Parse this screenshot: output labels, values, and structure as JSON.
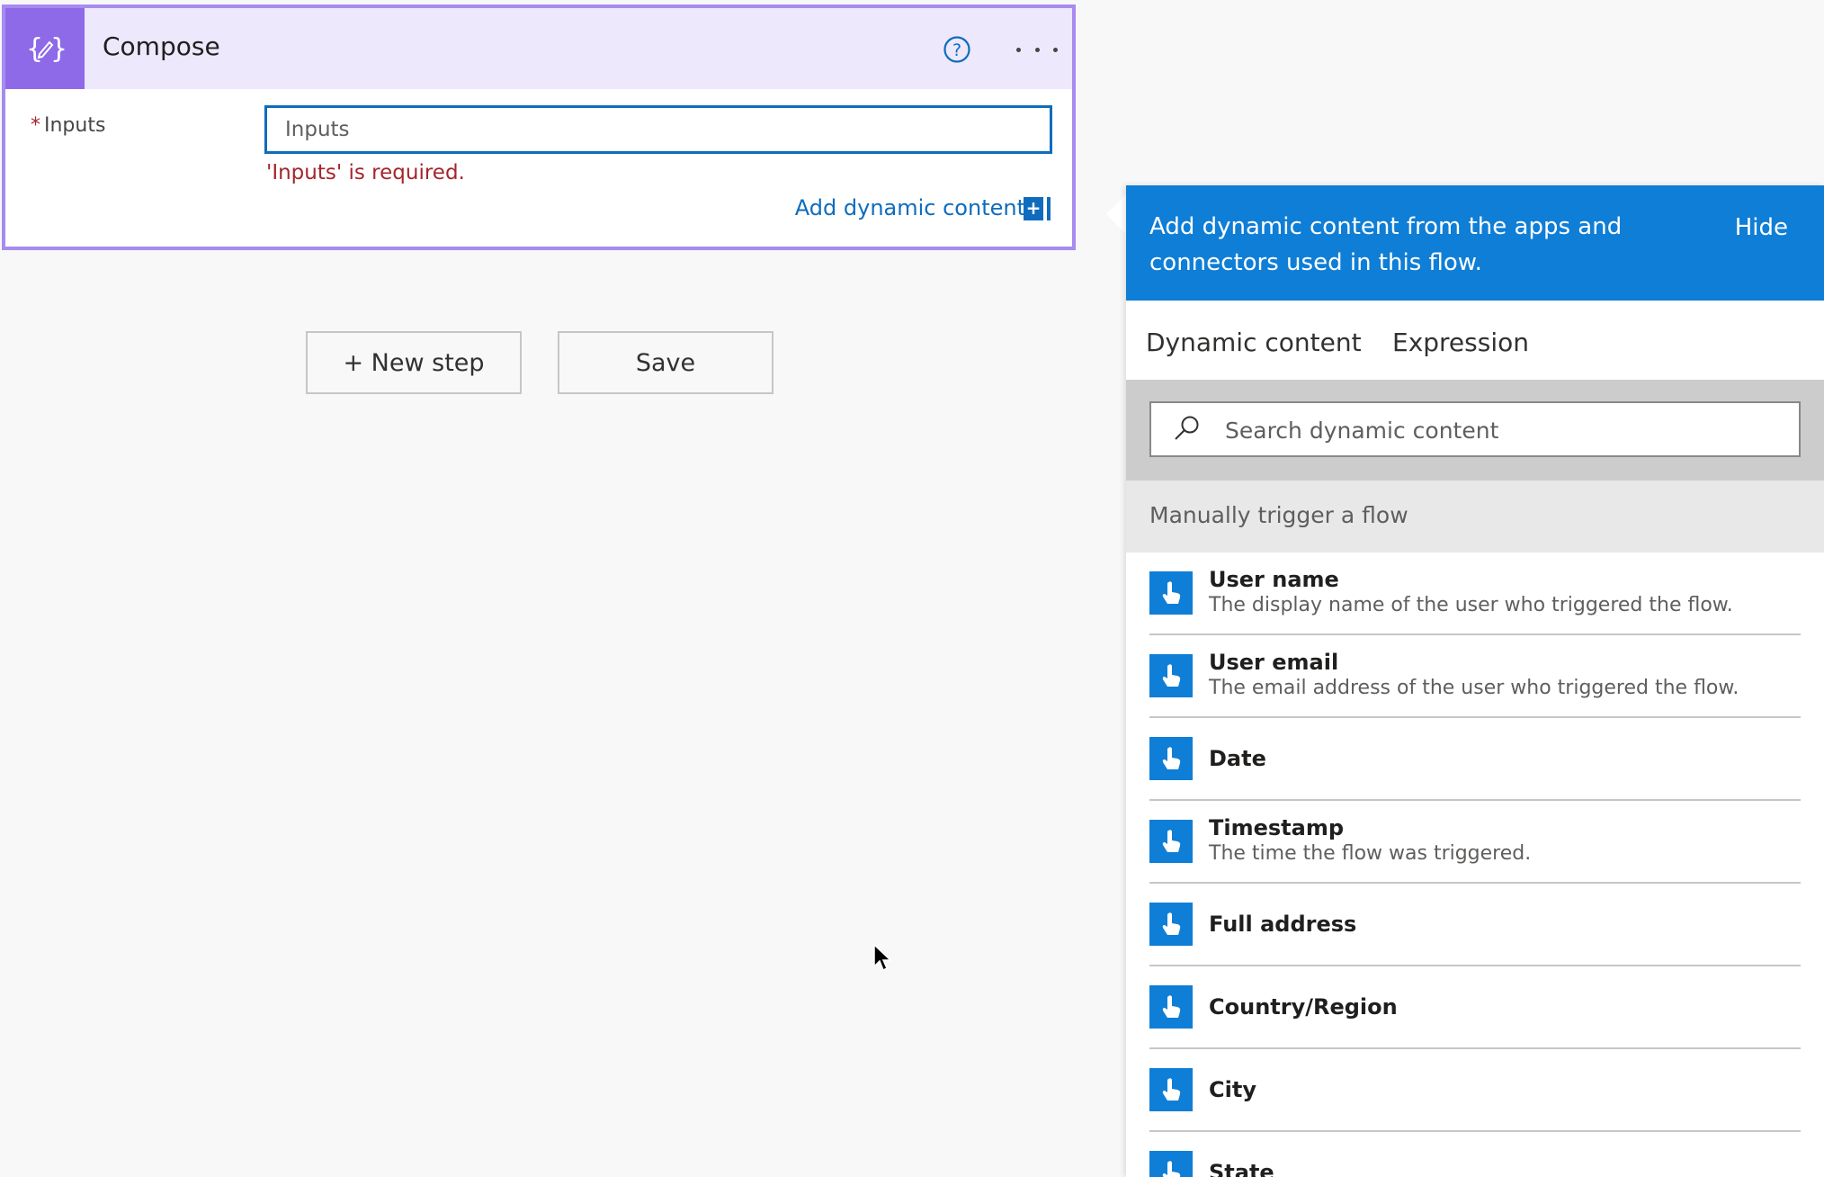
{
  "compose": {
    "title": "Compose",
    "inputs_label": "Inputs",
    "required_marker": "*",
    "inputs_placeholder": "Inputs",
    "inputs_value": "",
    "error": "'Inputs' is required.",
    "add_dynamic_label": "Add dynamic content",
    "add_dynamic_icon_glyph": "+",
    "header_color": "#ede8fb",
    "icon_color": "#8e6ae8",
    "border_color": "#a78bf0"
  },
  "actions": {
    "new_step_label": "+ New step",
    "save_label": "Save"
  },
  "panel": {
    "header_text": "Add dynamic content from the apps and connectors used in this flow.",
    "hide_label": "Hide",
    "header_color": "#0f7ed6",
    "tabs": [
      {
        "label": "Dynamic content",
        "active": true
      },
      {
        "label": "Expression",
        "active": false
      }
    ],
    "search_placeholder": "Search dynamic content",
    "section_title": "Manually trigger a flow",
    "items": [
      {
        "title": "User name",
        "description": "The display name of the user who triggered the flow.",
        "icon": "touch-trigger-icon"
      },
      {
        "title": "User email",
        "description": "The email address of the user who triggered the flow.",
        "icon": "touch-trigger-icon"
      },
      {
        "title": "Date",
        "description": "",
        "icon": "touch-trigger-icon"
      },
      {
        "title": "Timestamp",
        "description": "The time the flow was triggered.",
        "icon": "touch-trigger-icon"
      },
      {
        "title": "Full address",
        "description": "",
        "icon": "touch-trigger-icon"
      },
      {
        "title": "Country/Region",
        "description": "",
        "icon": "touch-trigger-icon"
      },
      {
        "title": "City",
        "description": "",
        "icon": "touch-trigger-icon"
      },
      {
        "title": "State",
        "description": "",
        "icon": "touch-trigger-icon"
      }
    ]
  }
}
